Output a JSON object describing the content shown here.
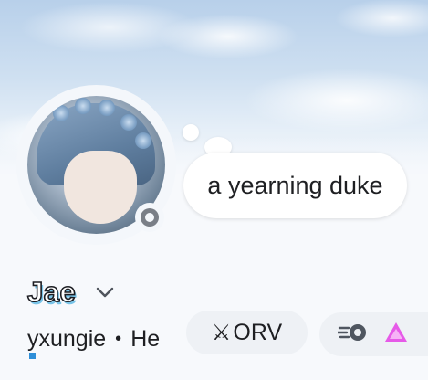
{
  "profile": {
    "display_name": "Jae",
    "username": "yxungie",
    "pronouns": "He",
    "separator": "•",
    "custom_status": "a yearning duke",
    "presence": "idle-offline",
    "server_tag": {
      "icon": "crossed-swords-icon",
      "glyph": "⚔",
      "label": "ORV"
    },
    "badges": [
      {
        "name": "nitro-badge"
      },
      {
        "name": "server-boost-badge"
      }
    ]
  },
  "colors": {
    "name_fill": "#ffffff",
    "name_outline": "#1c1d22",
    "name_shadow": "#79c4e8",
    "boost_badge": "#e65ae8",
    "nitro_badge": "#4f5660",
    "pill_bg": "#eef1f5",
    "status_dot": "#7a7f87"
  }
}
